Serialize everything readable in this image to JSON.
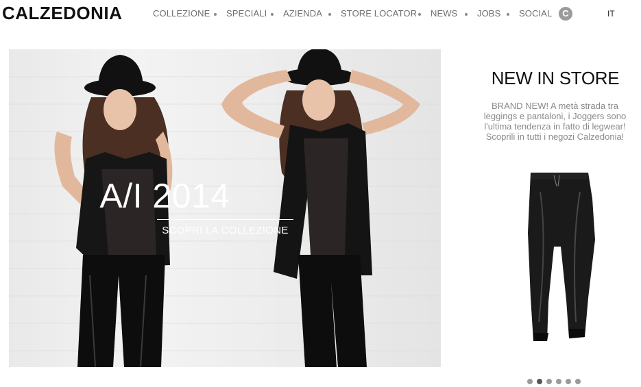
{
  "header": {
    "logo": "CALZEDONIA",
    "nav": [
      "COLLEZIONE",
      "SPECIALI",
      "AZIENDA",
      "STORE LOCATOR",
      "NEWS",
      "JOBS",
      "SOCIAL"
    ],
    "social_icon": "C",
    "language": "IT"
  },
  "hero": {
    "title": "A/I 2014",
    "cta": "SCOPRI LA COLLEZIONE"
  },
  "promo": {
    "title": "NEW IN STORE",
    "text": "BRAND NEW! A metà strada tra leggings e pantaloni, i Joggers sono l'ultima tendenza in fatto di legwear! Scoprili in tutti i negozi Calzedonia!"
  },
  "pagination": {
    "count": 6,
    "active_index": 1
  },
  "colors": {
    "nav_text": "#6e6e6e",
    "dot": "#9a9a9a",
    "dot_active": "#555555",
    "hero_text": "#ffffff"
  },
  "icons": [
    "c-social-icon",
    "jogger-pants-image",
    "model-image"
  ]
}
